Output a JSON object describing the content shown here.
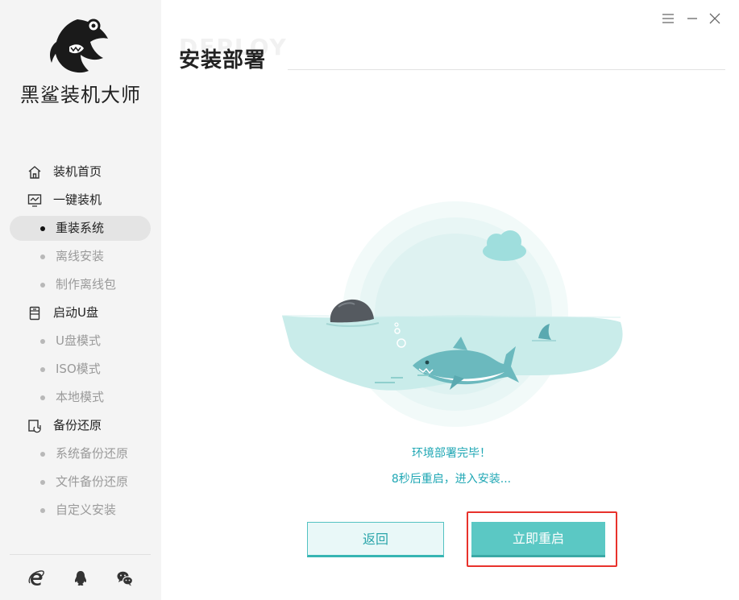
{
  "app": {
    "title": "黑鲨装机大师"
  },
  "sidebar": {
    "items": [
      {
        "label": "装机首页",
        "icon": "home-icon",
        "type": "top"
      },
      {
        "label": "一键装机",
        "icon": "monitor-icon",
        "type": "top"
      },
      {
        "label": "重装系统",
        "type": "sub",
        "active": true
      },
      {
        "label": "离线安装",
        "type": "sub"
      },
      {
        "label": "制作离线包",
        "type": "sub"
      },
      {
        "label": "启动U盘",
        "icon": "usb-drive-icon",
        "type": "top"
      },
      {
        "label": "U盘模式",
        "type": "sub"
      },
      {
        "label": "ISO模式",
        "type": "sub"
      },
      {
        "label": "本地模式",
        "type": "sub"
      },
      {
        "label": "备份还原",
        "icon": "backup-icon",
        "type": "top"
      },
      {
        "label": "系统备份还原",
        "type": "sub"
      },
      {
        "label": "文件备份还原",
        "type": "sub"
      },
      {
        "label": "自定义安装",
        "type": "sub"
      }
    ],
    "social_icons": [
      "ie-browser-icon",
      "qq-icon",
      "wechat-icon"
    ]
  },
  "header": {
    "watermark": "DEPLOY",
    "title": "安装部署"
  },
  "window_controls": [
    "menu-icon",
    "minimize-icon",
    "close-icon"
  ],
  "main": {
    "status_line1": "环境部署完毕！",
    "status_line2": "8秒后重启，进入安装...",
    "back_button": "返回",
    "restart_button": "立即重启"
  },
  "colors": {
    "accent": "#5bc8c4",
    "status_text": "#1fa7b4",
    "highlight": "#e8322c",
    "sidebar_bg": "#f4f4f4"
  }
}
